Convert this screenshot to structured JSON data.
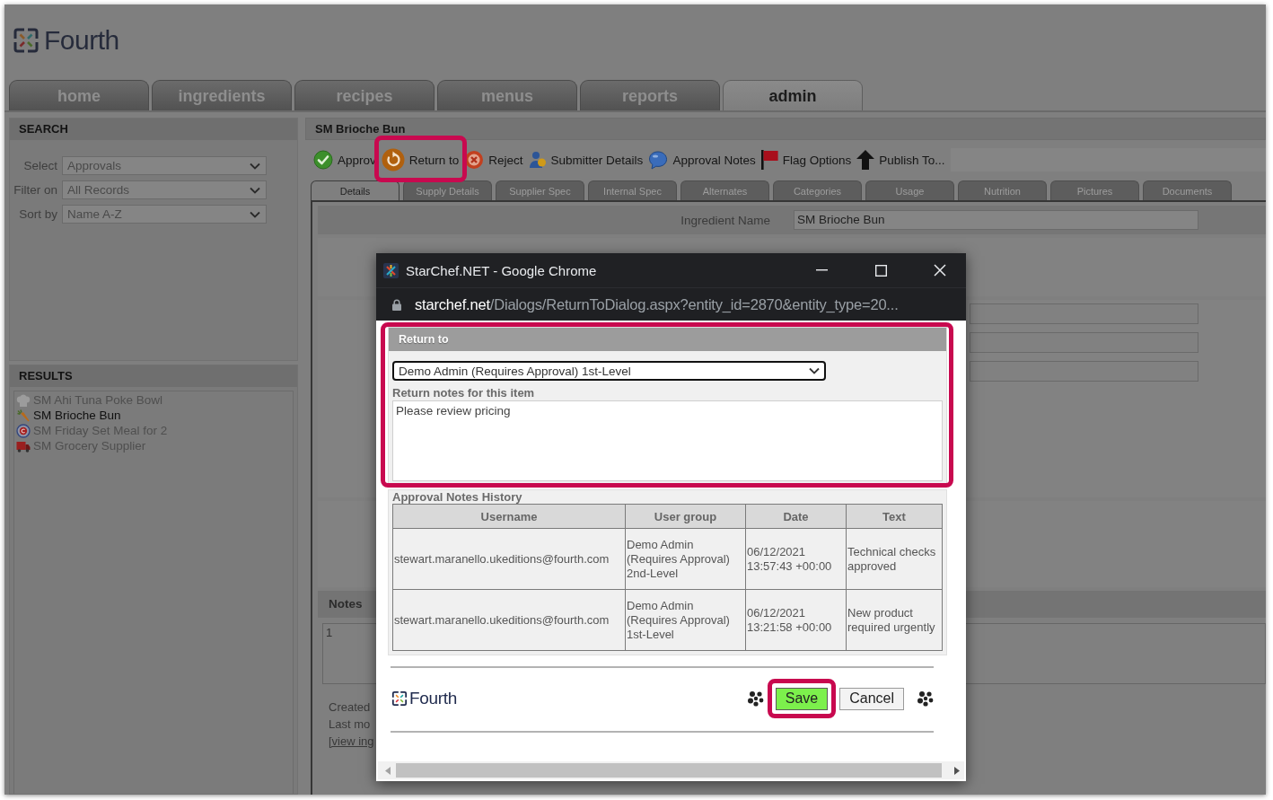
{
  "logo": {
    "text": "Fourth"
  },
  "nav_tabs": [
    {
      "label": "home",
      "selected": false
    },
    {
      "label": "ingredients",
      "selected": false
    },
    {
      "label": "recipes",
      "selected": false
    },
    {
      "label": "menus",
      "selected": false
    },
    {
      "label": "reports",
      "selected": false
    },
    {
      "label": "admin",
      "selected": true
    }
  ],
  "search_panel": {
    "title": "SEARCH",
    "filters": [
      {
        "label": "Select",
        "value": "Approvals"
      },
      {
        "label": "Filter on",
        "value": "All Records"
      },
      {
        "label": "Sort by",
        "value": "Name A-Z"
      }
    ]
  },
  "results_panel": {
    "title": "RESULTS",
    "items": [
      {
        "label": "SM Ahi Tuna Poke Bowl",
        "kind": "recipe",
        "selected": false
      },
      {
        "label": "SM Brioche Bun",
        "kind": "ingredient",
        "selected": true
      },
      {
        "label": "SM Friday Set Meal for 2",
        "kind": "menu",
        "selected": false
      },
      {
        "label": "SM Grocery Supplier",
        "kind": "supplier",
        "selected": false
      }
    ]
  },
  "detail": {
    "title": "SM Brioche Bun",
    "toolbar": [
      {
        "label": "Approv",
        "kind": "approve",
        "highlighted": false
      },
      {
        "label": "Return to",
        "kind": "return",
        "highlighted": true
      },
      {
        "label": "Reject",
        "kind": "reject",
        "highlighted": false
      },
      {
        "label": "Submitter Details",
        "kind": "submitter",
        "highlighted": false
      },
      {
        "label": "Approval Notes",
        "kind": "notes",
        "highlighted": false
      },
      {
        "label": "Flag Options",
        "kind": "flag",
        "highlighted": false
      },
      {
        "label": "Publish To...",
        "kind": "publish",
        "highlighted": false
      }
    ],
    "tabs": [
      {
        "label": "Details",
        "selected": true
      },
      {
        "label": "Supply Details",
        "selected": false
      },
      {
        "label": "Supplier Spec",
        "selected": false
      },
      {
        "label": "Internal Spec",
        "selected": false
      },
      {
        "label": "Alternates",
        "selected": false
      },
      {
        "label": "Categories",
        "selected": false
      },
      {
        "label": "Usage",
        "selected": false
      },
      {
        "label": "Nutrition",
        "selected": false
      },
      {
        "label": "Pictures",
        "selected": false
      },
      {
        "label": "Documents",
        "selected": false
      }
    ],
    "fields": [
      {
        "label": "Ingredient Name",
        "value": "SM Brioche Bun"
      }
    ],
    "notes": {
      "title": "Notes",
      "value": "1"
    },
    "meta": [
      {
        "text": "Created",
        "kind": "text"
      },
      {
        "text": "Last mo",
        "kind": "text"
      },
      {
        "text": "[view ing",
        "kind": "link"
      }
    ]
  },
  "dialog": {
    "title": "StarChef.NET - Google Chrome",
    "url": {
      "host": "starchef.net",
      "path": "/Dialogs/ReturnToDialog.aspx?entity_id=2870&entity_type=20..."
    },
    "form": {
      "title": "Return to",
      "highlighted": true,
      "recipient": "Demo Admin (Requires Approval) 1st-Level",
      "notes_label": "Return notes for this item",
      "notes_value": "Please review pricing"
    },
    "history": {
      "title": "Approval Notes History",
      "columns": [
        "Username",
        "User group",
        "Date",
        "Text"
      ],
      "rows": [
        [
          "stewart.maranello.ukeditions@fourth.com",
          "Demo Admin (Requires Approval) 2nd-Level",
          "06/12/2021 13:57:43 +00:00",
          "Technical checks approved"
        ],
        [
          "stewart.maranello.ukeditions@fourth.com",
          "Demo Admin (Requires Approval) 1st-Level",
          "06/12/2021 13:21:58 +00:00",
          "New product required urgently"
        ]
      ]
    },
    "footer_logo": {
      "text": "Fourth"
    },
    "buttons": [
      {
        "label": "Save",
        "kind": "primary",
        "highlighted": true
      },
      {
        "label": "Cancel",
        "kind": "secondary",
        "highlighted": false
      }
    ]
  }
}
